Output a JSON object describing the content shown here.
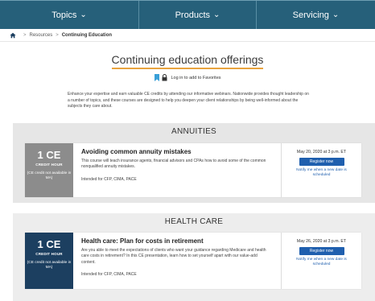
{
  "nav": {
    "items": [
      {
        "label": "Topics",
        "caret": "⌄"
      },
      {
        "label": "Products",
        "caret": "⌄"
      },
      {
        "label": "Servicing",
        "caret": "⌄"
      }
    ],
    "background": "#26607a"
  },
  "breadcrumb": {
    "items": [
      "Resources",
      "Continuing Education"
    ],
    "separator": ">"
  },
  "page": {
    "title": "Continuing education offerings",
    "login_text": "Log in to add to Favorites",
    "intro": "Enhance your expertise and earn valuable CE credits by attending our informative webinars. Nationwide provides thought leadership on a number of topics, and these courses are designed to help you deepen your client relationships by being well-informed about the subjects they care about."
  },
  "sections": [
    {
      "title": "ANNUITIES",
      "course": {
        "ce_number": "1 CE",
        "ce_unit": "CREDIT HOUR",
        "ce_note": "(CE credit not available in MA)",
        "title": "Avoiding common annuity mistakes",
        "description": "This course will teach insurance agents, financial advisors and CPAs how to avoid some of the common nonqualified annuity mistakes.",
        "intended": "Intended for CFP, CIMA, PACE",
        "date": "May 20, 2020 at 3 p.m. ET",
        "register_label": "Register now",
        "notify_label": "Notify me when a new date is scheduled"
      }
    },
    {
      "title": "HEALTH CARE",
      "course": {
        "ce_number": "1 CE",
        "ce_unit": "CREDIT HOUR",
        "ce_note": "(CE credit not available in MA)",
        "title": "Health care: Plan for costs in retirement",
        "description": "Are you able to meet the expectations of clients who want your guidance regarding Medicare and health care costs in retirement? In this CE presentation, learn how to set yourself apart with our value-add content.",
        "intended": "Intended for CFP, CIMA, PACE",
        "date": "May 26, 2020 at 3 p.m. ET",
        "register_label": "Register now",
        "notify_label": "Notify me when a new date is scheduled"
      }
    }
  ],
  "colors": {
    "accent_underline": "#e8a33d",
    "register_button": "#1f5fae",
    "ce_grey": "#8c8c8c",
    "ce_navy": "#1c3f60"
  },
  "icons": [
    "home-icon",
    "favorite-add-icon",
    "lock-icon",
    "chevron-down-icon"
  ]
}
